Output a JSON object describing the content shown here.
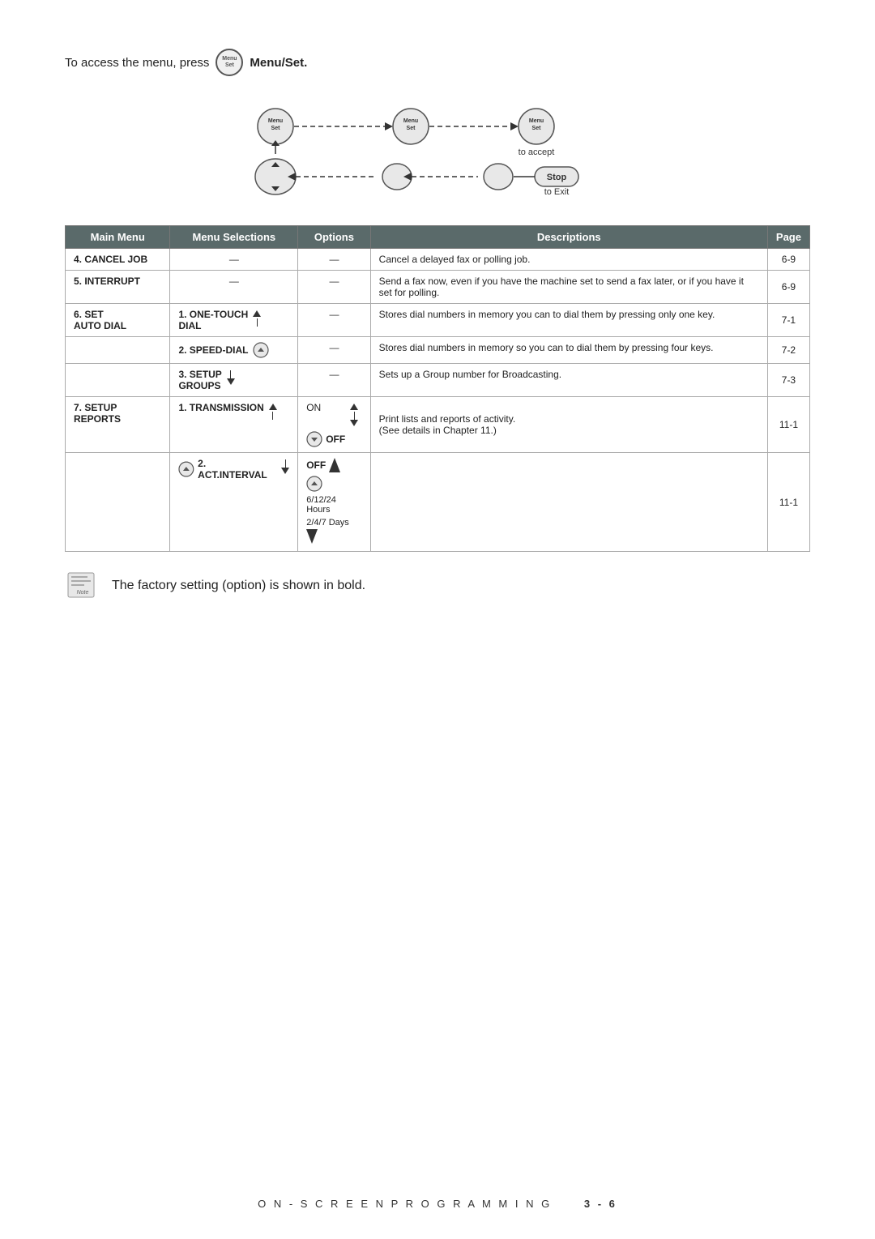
{
  "intro": {
    "text_before": "To access the menu, press",
    "button_label": "Menu\nSet",
    "text_after": "Menu/Set."
  },
  "diagram": {
    "label_accept": "to accept",
    "label_exit": "to Exit",
    "stop_label": "Stop"
  },
  "table": {
    "headers": [
      "Main Menu",
      "Menu Selections",
      "Options",
      "Descriptions",
      "Page"
    ],
    "rows": [
      {
        "main_menu": "4. CANCEL JOB",
        "menu_sel": "—",
        "options": "—",
        "description": "Cancel a delayed fax or polling job.",
        "page": "6-9"
      },
      {
        "main_menu": "5. INTERRUPT",
        "menu_sel": "—",
        "options": "—",
        "description": "Send a fax now, even if you have the machine set to send a fax later, or if you have it set for polling.",
        "page": "6-9"
      },
      {
        "main_menu": "6. SET\nAUTO DIAL",
        "menu_sel": "1. ONE-TOUCH\nDIAL",
        "options": "—",
        "description": "Stores dial numbers in memory you can to dial them by pressing only one key.",
        "page": "7-1"
      },
      {
        "main_menu": "",
        "menu_sel": "2. SPEED-DIAL",
        "options": "—",
        "description": "Stores dial numbers in memory so you can to dial them by pressing four keys.",
        "page": "7-2"
      },
      {
        "main_menu": "",
        "menu_sel": "3. SETUP\nGROUPS",
        "options": "—",
        "description": "Sets up a Group number for Broadcasting.",
        "page": "7-3"
      },
      {
        "main_menu": "7. SETUP REPORTS",
        "menu_sel": "1. TRANSMISSION",
        "options_top": "ON",
        "options_bold": "OFF",
        "description": "Print lists and reports of activity.\n(See details in Chapter 11.)",
        "page": "11-1"
      },
      {
        "main_menu": "",
        "menu_sel": "2. ACT.INTERVAL",
        "options_bold": "OFF",
        "options_bottom1": "6/12/24 Hours",
        "options_bottom2": "2/4/7 Days",
        "description": "",
        "page": "11-1"
      }
    ]
  },
  "note": {
    "text": "The factory setting (option) is shown in bold."
  },
  "footer": {
    "text": "O N - S C R E E N   P R O G R A M M I N G",
    "page": "3 - 6"
  }
}
